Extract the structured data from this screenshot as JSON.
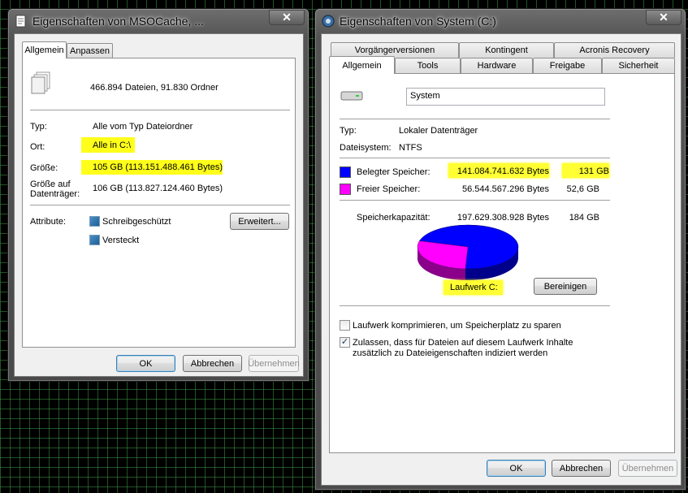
{
  "left_window": {
    "title": "Eigenschaften von MSOCache, ...",
    "tabs": [
      "Allgemein",
      "Anpassen"
    ],
    "summary": "466.894 Dateien, 91.830 Ordner",
    "type_label": "Typ:",
    "type_value": "Alle vom Typ Dateiordner",
    "location_label": "Ort:",
    "location_value": "Alle in C:\\",
    "size_label": "Größe:",
    "size_value": "105 GB (113.151.488.461 Bytes)",
    "disk_size_label_1": "Größe auf",
    "disk_size_label_2": "Datenträger:",
    "disk_size_value": "106 GB (113.827.124.460 Bytes)",
    "attributes_label": "Attribute:",
    "readonly_label": "Schreibgeschützt",
    "hidden_label": "Versteckt",
    "advanced_button": "Erweitert...",
    "ok_button": "OK",
    "cancel_button": "Abbrechen",
    "apply_button": "Übernehmen"
  },
  "right_window": {
    "title": "Eigenschaften von System (C:)",
    "tabs_back": [
      "Vorgängerversionen",
      "Kontingent",
      "Acronis Recovery"
    ],
    "tabs_front": [
      "Allgemein",
      "Tools",
      "Hardware",
      "Freigabe",
      "Sicherheit"
    ],
    "volume_name": "System",
    "type_label": "Typ:",
    "type_value": "Lokaler Datenträger",
    "fs_label": "Dateisystem:",
    "fs_value": "NTFS",
    "used_label": "Belegter Speicher:",
    "used_bytes": "141.084.741.632 Bytes",
    "used_gb": "131 GB",
    "free_label": "Freier Speicher:",
    "free_bytes": "56.544.567.296 Bytes",
    "free_gb": "52,6 GB",
    "capacity_label": "Speicherkapazität:",
    "capacity_bytes": "197.629.308.928 Bytes",
    "capacity_gb": "184 GB",
    "drive_label": "Laufwerk C:",
    "cleanup_button": "Bereinigen",
    "compress_label": "Laufwerk komprimieren, um Speicherplatz zu sparen",
    "index_label_1": "Zulassen, dass für Dateien auf diesem Laufwerk Inhalte",
    "index_label_2": "zusätzlich zu Dateieigenschaften indiziert werden",
    "compress_checked": false,
    "index_checked": true,
    "ok_button": "OK",
    "cancel_button": "Abbrechen",
    "apply_button": "Übernehmen",
    "colors": {
      "used": "#0000ff",
      "free": "#ff00ff"
    },
    "used_fraction": 0.714
  },
  "close_glyph": "✕"
}
